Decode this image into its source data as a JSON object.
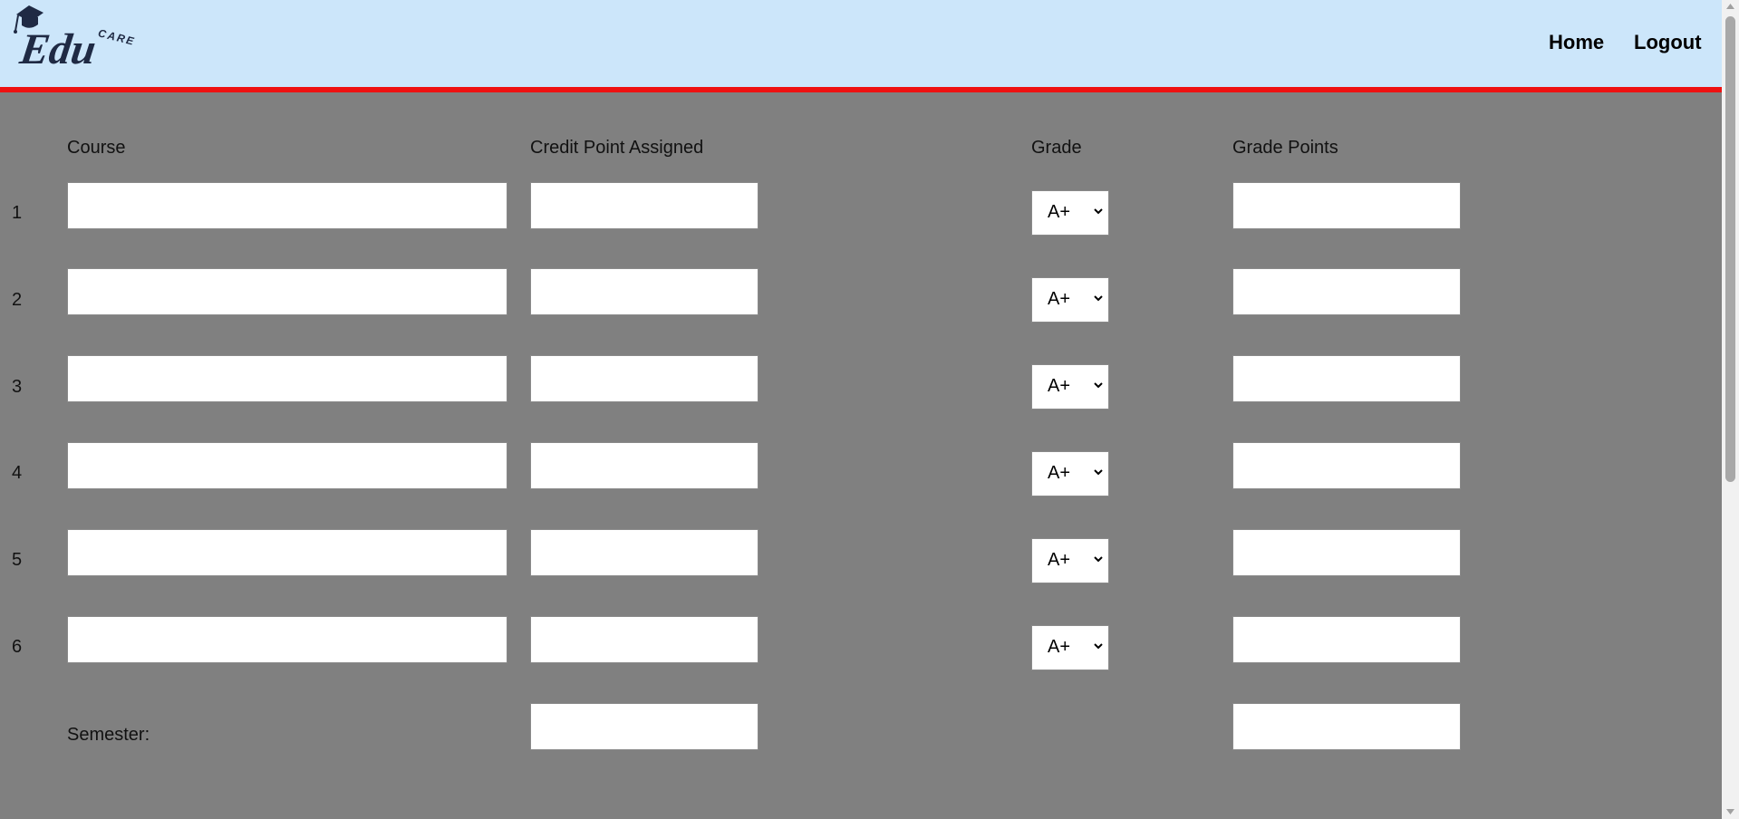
{
  "header": {
    "logo_text": "Edu",
    "logo_subtext": "CARE",
    "nav": {
      "home": "Home",
      "logout": "Logout"
    }
  },
  "table": {
    "headers": {
      "course": "Course",
      "credit": "Credit Point Assigned",
      "grade": "Grade",
      "grade_points": "Grade Points"
    },
    "rows": [
      {
        "num": "1",
        "course": "",
        "credit": "",
        "grade": "A+",
        "grade_points": ""
      },
      {
        "num": "2",
        "course": "",
        "credit": "",
        "grade": "A+",
        "grade_points": ""
      },
      {
        "num": "3",
        "course": "",
        "credit": "",
        "grade": "A+",
        "grade_points": ""
      },
      {
        "num": "4",
        "course": "",
        "credit": "",
        "grade": "A+",
        "grade_points": ""
      },
      {
        "num": "5",
        "course": "",
        "credit": "",
        "grade": "A+",
        "grade_points": ""
      },
      {
        "num": "6",
        "course": "",
        "credit": "",
        "grade": "A+",
        "grade_points": ""
      }
    ],
    "semester": {
      "label": "Semester:",
      "credit_total": "",
      "grade_points_total": ""
    }
  },
  "colors": {
    "header_bg": "#cce6fa",
    "accent": "#ee1111",
    "page_bg": "#808080",
    "logo": "#1f2a44"
  }
}
